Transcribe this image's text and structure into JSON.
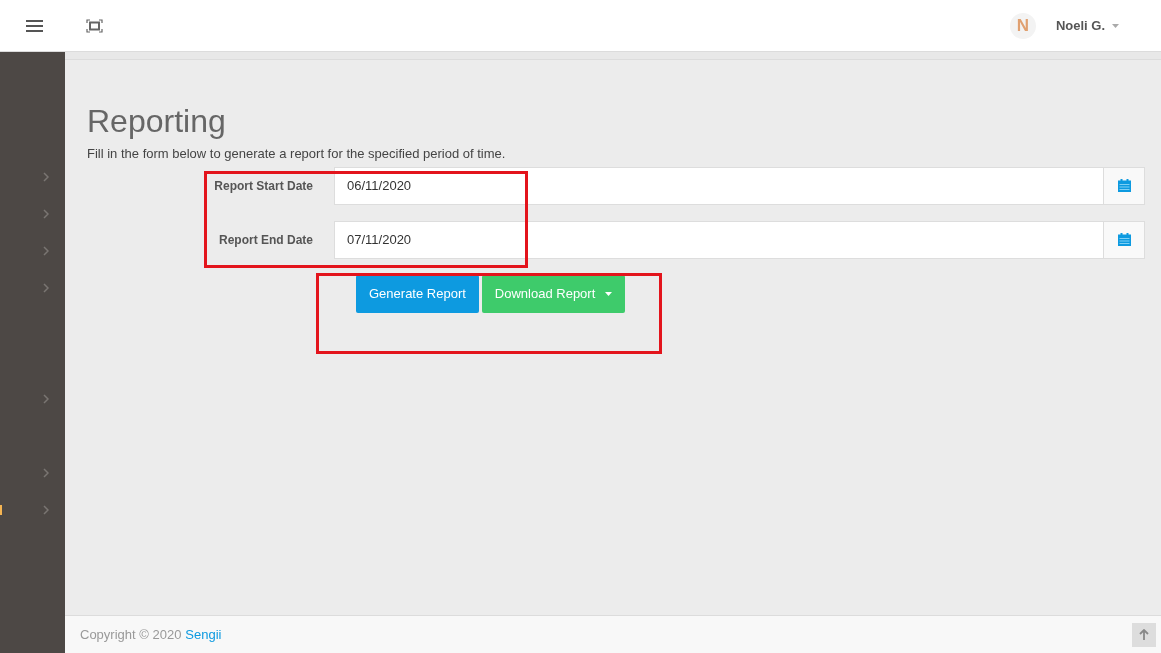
{
  "topbar": {
    "avatar_letter": "N",
    "user_name": "Noeli G."
  },
  "sidebar": {
    "items": [
      {
        "expandable": true,
        "selected": false
      },
      {
        "expandable": true,
        "selected": false
      },
      {
        "expandable": true,
        "selected": false
      },
      {
        "expandable": true,
        "selected": false
      },
      {
        "expandable": false,
        "selected": false
      },
      {
        "expandable": false,
        "selected": false
      },
      {
        "expandable": true,
        "selected": false
      },
      {
        "expandable": false,
        "selected": false
      },
      {
        "expandable": true,
        "selected": false
      },
      {
        "expandable": true,
        "selected": true
      }
    ]
  },
  "page": {
    "title": "Reporting",
    "subtitle": "Fill in the form below to generate a report for the specified period of time."
  },
  "form": {
    "fields": [
      {
        "label": "Report Start Date",
        "value": "06/11/2020"
      },
      {
        "label": "Report End Date",
        "value": "07/11/2020"
      }
    ],
    "buttons": [
      {
        "kind": "primary",
        "label": "Generate Report"
      },
      {
        "kind": "dropdown",
        "label": "Download Report"
      }
    ]
  },
  "annotations": {
    "fields_highlighted": true,
    "buttons_highlighted": true
  },
  "footer": {
    "copyright": "Copyright © 2020",
    "link": "Sengii"
  }
}
